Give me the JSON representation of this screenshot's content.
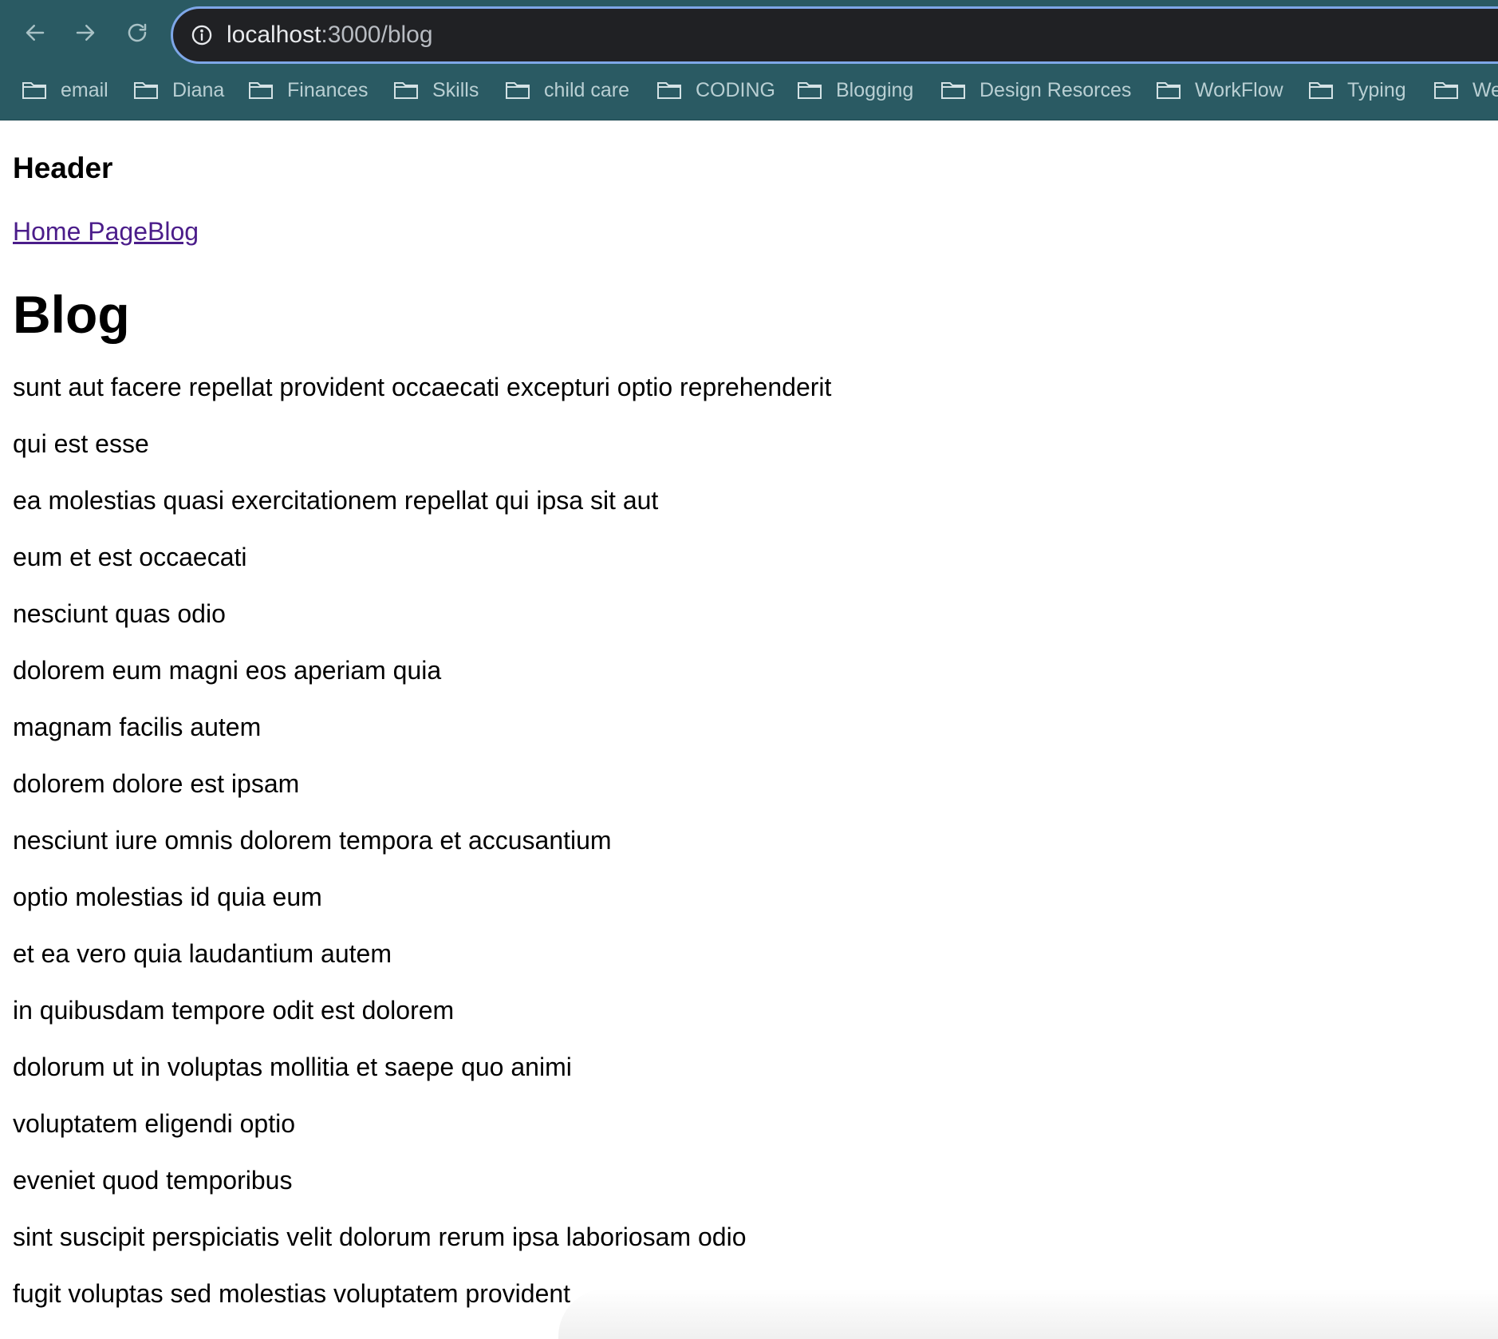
{
  "browser": {
    "url_host": "localhost",
    "url_path": ":3000/blog",
    "bookmarks": [
      {
        "label": "email"
      },
      {
        "label": "Diana"
      },
      {
        "label": "Finances"
      },
      {
        "label": "Skills"
      },
      {
        "label": "child care"
      },
      {
        "label": "CODING"
      },
      {
        "label": "Blogging"
      },
      {
        "label": "Design Resorces"
      },
      {
        "label": "WorkFlow"
      },
      {
        "label": "Typing"
      },
      {
        "label": "We"
      }
    ]
  },
  "page": {
    "header": "Header",
    "nav": {
      "home_label": "Home Page",
      "blog_label": "Blog"
    },
    "title": "Blog",
    "posts": [
      "sunt aut facere repellat provident occaecati excepturi optio reprehenderit",
      "qui est esse",
      "ea molestias quasi exercitationem repellat qui ipsa sit aut",
      "eum et est occaecati",
      "nesciunt quas odio",
      "dolorem eum magni eos aperiam quia",
      "magnam facilis autem",
      "dolorem dolore est ipsam",
      "nesciunt iure omnis dolorem tempora et accusantium",
      "optio molestias id quia eum",
      "et ea vero quia laudantium autem",
      "in quibusdam tempore odit est dolorem",
      "dolorum ut in voluptas mollitia et saepe quo animi",
      "voluptatem eligendi optio",
      "eveniet quod temporibus",
      "sint suscipit perspiciatis velit dolorum rerum ipsa laboriosam odio",
      "fugit voluptas sed molestias voluptatem provident"
    ]
  }
}
